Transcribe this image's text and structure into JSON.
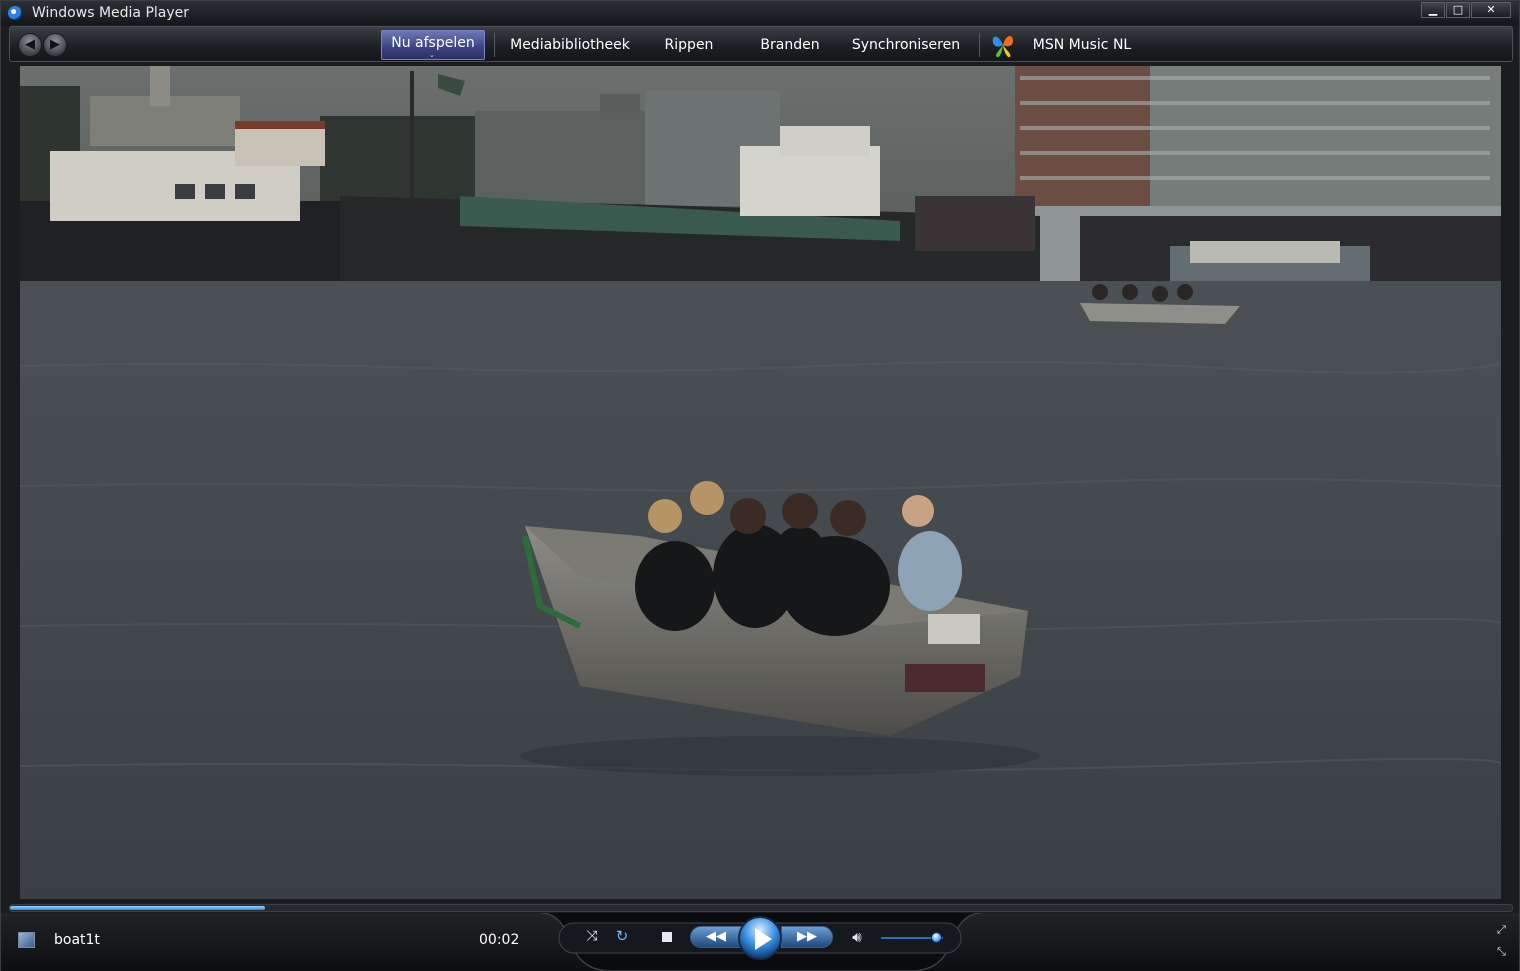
{
  "window": {
    "title": "Windows Media Player",
    "minimize": "▁",
    "maximize": "□",
    "close": "✕"
  },
  "nav": {
    "back": "◀",
    "forward": "▶",
    "tabs": [
      {
        "label": "Nu afspelen",
        "active": true
      },
      {
        "label": "Mediabibliotheek"
      },
      {
        "label": "Rippen"
      },
      {
        "label": "Branden"
      },
      {
        "label": "Synchroniseren"
      },
      {
        "label": "MSN Music NL"
      }
    ],
    "caret": "⌄"
  },
  "playback": {
    "track_name": "boat1t",
    "elapsed": "00:02",
    "seek_progress": 0.17,
    "volume": 0.9,
    "shuffle": "⤨",
    "repeat": "↻",
    "prev": "◀◀",
    "next": "▶▶",
    "volume_glyph": "🔊︎",
    "mini_mode": "⤢",
    "fullscreen": "⤡"
  },
  "colors": {
    "accent": "#3c8fe2",
    "active_tab": "#4b5296",
    "chrome": "#1a1c1f"
  }
}
